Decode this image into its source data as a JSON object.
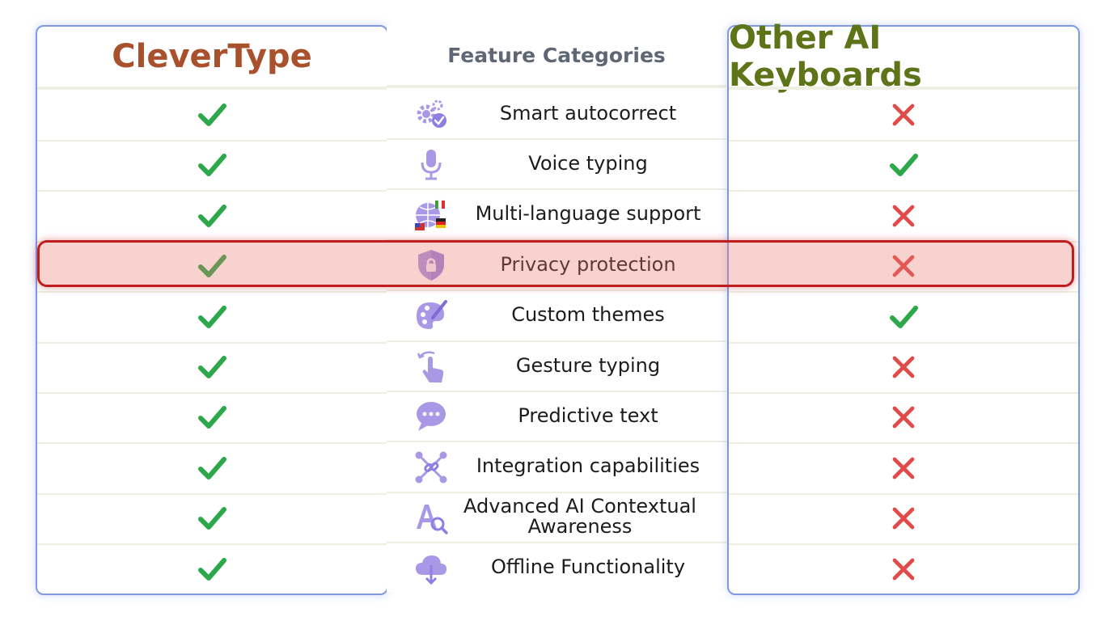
{
  "headers": {
    "left": "CleverType",
    "middle": "Feature Categories",
    "right": "Other AI Keyboards"
  },
  "colors": {
    "check": "#2ca84a",
    "cross": "#e24a4a",
    "highlight_border": "#c01e1e",
    "panel_border": "#7f9ae0",
    "icon": "#a998e6"
  },
  "features": [
    {
      "label": "Smart autocorrect",
      "icon": "gears-check-icon",
      "clevertype": "check",
      "other": "cross"
    },
    {
      "label": "Voice typing",
      "icon": "microphone-icon",
      "clevertype": "check",
      "other": "check"
    },
    {
      "label": "Multi-language support",
      "icon": "globe-flags-icon",
      "clevertype": "check",
      "other": "cross"
    },
    {
      "label": "Privacy protection",
      "icon": "shield-lock-icon",
      "clevertype": "check",
      "other": "cross"
    },
    {
      "label": "Custom themes",
      "icon": "palette-icon",
      "clevertype": "check",
      "other": "check"
    },
    {
      "label": "Gesture typing",
      "icon": "swipe-hand-icon",
      "clevertype": "check",
      "other": "cross"
    },
    {
      "label": "Predictive text",
      "icon": "chat-bubble-icon",
      "clevertype": "check",
      "other": "cross"
    },
    {
      "label": "Integration capabilities",
      "icon": "link-nodes-icon",
      "clevertype": "check",
      "other": "cross"
    },
    {
      "label": "Advanced AI Contextual Awareness",
      "icon": "text-search-icon",
      "clevertype": "check",
      "other": "cross"
    },
    {
      "label": "Offline Functionality",
      "icon": "cloud-download-icon",
      "clevertype": "check",
      "other": "cross"
    }
  ],
  "highlighted_row": "Privacy protection"
}
